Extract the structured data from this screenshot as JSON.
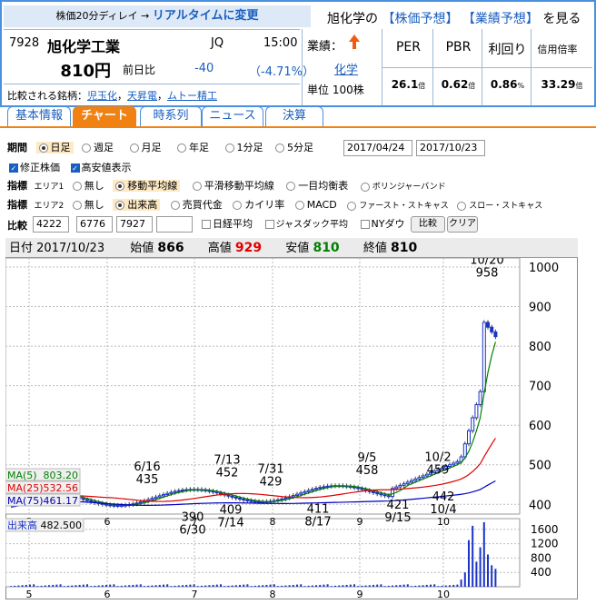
{
  "header": {
    "delay_text": "株価20分ディレイ →",
    "realtime_link": "リアルタイムに変更",
    "brand_prefix": "旭化学の",
    "forecast_link": "【株価予想】",
    "earnings_link": "【業績予想】",
    "brand_suffix": "を見る",
    "code": "7928",
    "name": "旭化学工業",
    "market": "JQ",
    "time": "15:00",
    "price": "810円",
    "prev_label": "前日比",
    "change": "-40",
    "change_pct": "（-4.71%）",
    "compare_label": "比較される銘柄：",
    "compare_links": [
      "児玉化",
      "天昇電",
      "ムトー精工"
    ],
    "gyoseki_label": "業績：",
    "industry_link": "化学",
    "unit_text": "単位 100株",
    "kpis": [
      {
        "label": "PER",
        "value": "26.1",
        "unit": "倍"
      },
      {
        "label": "PBR",
        "value": "0.62",
        "unit": "倍"
      },
      {
        "label": "利回り",
        "value": "0.86",
        "unit": "%"
      },
      {
        "label": "信用倍率",
        "value": "33.29",
        "unit": "倍"
      }
    ],
    "up_color": "#f05a14",
    "link_color": "#1a5fc0"
  },
  "tabs": [
    "基本情報",
    "チャート",
    "時系列",
    "ニュース",
    "決算"
  ],
  "active_tab": "チャート",
  "controls": {
    "period_label": "期間",
    "period_opts": [
      "日足",
      "週足",
      "月足",
      "年足",
      "1分足",
      "5分足"
    ],
    "date_from": "2017/04/24",
    "date_to": "2017/10/23",
    "adj_label": "修正株価",
    "hilo_label": "高安値表示",
    "ind1_label": "指標",
    "area1": "エリア1",
    "ind1_opts": [
      "無し",
      "移動平均線",
      "平滑移動平均線",
      "一目均衡表",
      "ボリンジャーバンド"
    ],
    "ind2_label": "指標",
    "area2": "エリア2",
    "ind2_opts": [
      "無し",
      "出来高",
      "売買代金",
      "カイリ率",
      "MACD",
      "ファースト・ストキャス",
      "スロー・ストキャス"
    ],
    "cmp_label": "比較",
    "cmp_codes": [
      "4222",
      "6776",
      "7927",
      ""
    ],
    "cmp_checks": [
      "日経平均",
      "ジャスダック平均",
      "NYダウ"
    ],
    "cmp_button": "比較",
    "clear_button": "クリア"
  },
  "info": {
    "date_label": "日付",
    "date": "2017/10/23",
    "open_label": "始値",
    "open": "866",
    "high_label": "高値",
    "high": "929",
    "low_label": "安値",
    "low": "810",
    "close_label": "終値",
    "close": "810",
    "high_color": "#e00000",
    "low_color": "#008000"
  },
  "ma": [
    {
      "label": "MA(5)",
      "value": "803.20",
      "color": "#008000"
    },
    {
      "label": "MA(25)",
      "value": "532.56",
      "color": "#e00000"
    },
    {
      "label": "MA(75)",
      "value": "461.17",
      "color": "#0000c0"
    }
  ],
  "volume_label": "出来高",
  "volume_value": "482.500",
  "chart_data": {
    "type": "candlestick",
    "price_ylim": [
      380,
      1000
    ],
    "price_ticks": [
      400,
      500,
      600,
      700,
      800,
      900,
      1000
    ],
    "volume_ticks": [
      400,
      800,
      1200,
      1600
    ],
    "x_ticks": [
      "5",
      "6",
      "7",
      "8",
      "9",
      "10"
    ],
    "annotations": [
      {
        "date": "6/16",
        "value": "435",
        "pos": "above"
      },
      {
        "date": "6/30",
        "value": "390",
        "pos": "below"
      },
      {
        "date": "7/13",
        "value": "452",
        "pos": "above"
      },
      {
        "date": "7/14",
        "value": "409",
        "pos": "below"
      },
      {
        "date": "7/31",
        "value": "429",
        "pos": "above"
      },
      {
        "date": "8/17",
        "value": "411",
        "pos": "below"
      },
      {
        "date": "9/5",
        "value": "458",
        "pos": "above"
      },
      {
        "date": "9/15",
        "value": "421",
        "pos": "below"
      },
      {
        "date": "10/2",
        "value": "459",
        "pos": "above"
      },
      {
        "date": "10/4",
        "value": "442",
        "pos": "below"
      },
      {
        "date": "10/20",
        "value": "958",
        "pos": "above"
      }
    ]
  }
}
